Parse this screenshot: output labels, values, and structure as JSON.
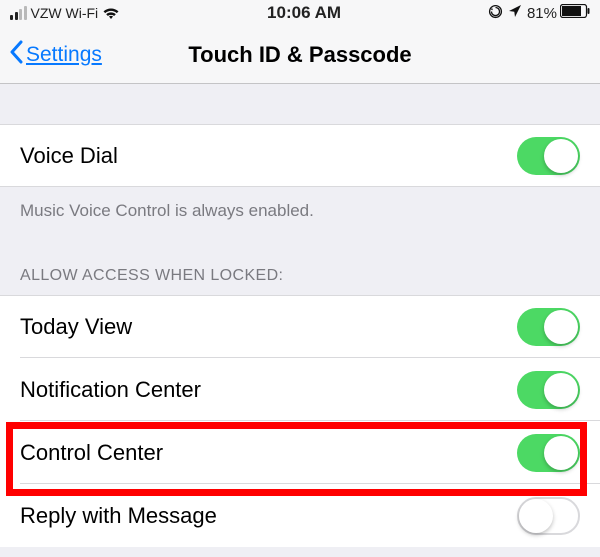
{
  "status": {
    "carrier": "VZW Wi-Fi",
    "time": "10:06 AM",
    "battery_pct": "81%"
  },
  "nav": {
    "back_label": "Settings",
    "title": "Touch ID & Passcode"
  },
  "voice_dial": {
    "label": "Voice Dial",
    "on": true,
    "footer": "Music Voice Control is always enabled."
  },
  "allow_access": {
    "header": "ALLOW ACCESS WHEN LOCKED:",
    "items": [
      {
        "label": "Today View",
        "on": true
      },
      {
        "label": "Notification Center",
        "on": true
      },
      {
        "label": "Control Center",
        "on": true
      },
      {
        "label": "Reply with Message",
        "on": false
      }
    ]
  },
  "highlight_index": 2
}
